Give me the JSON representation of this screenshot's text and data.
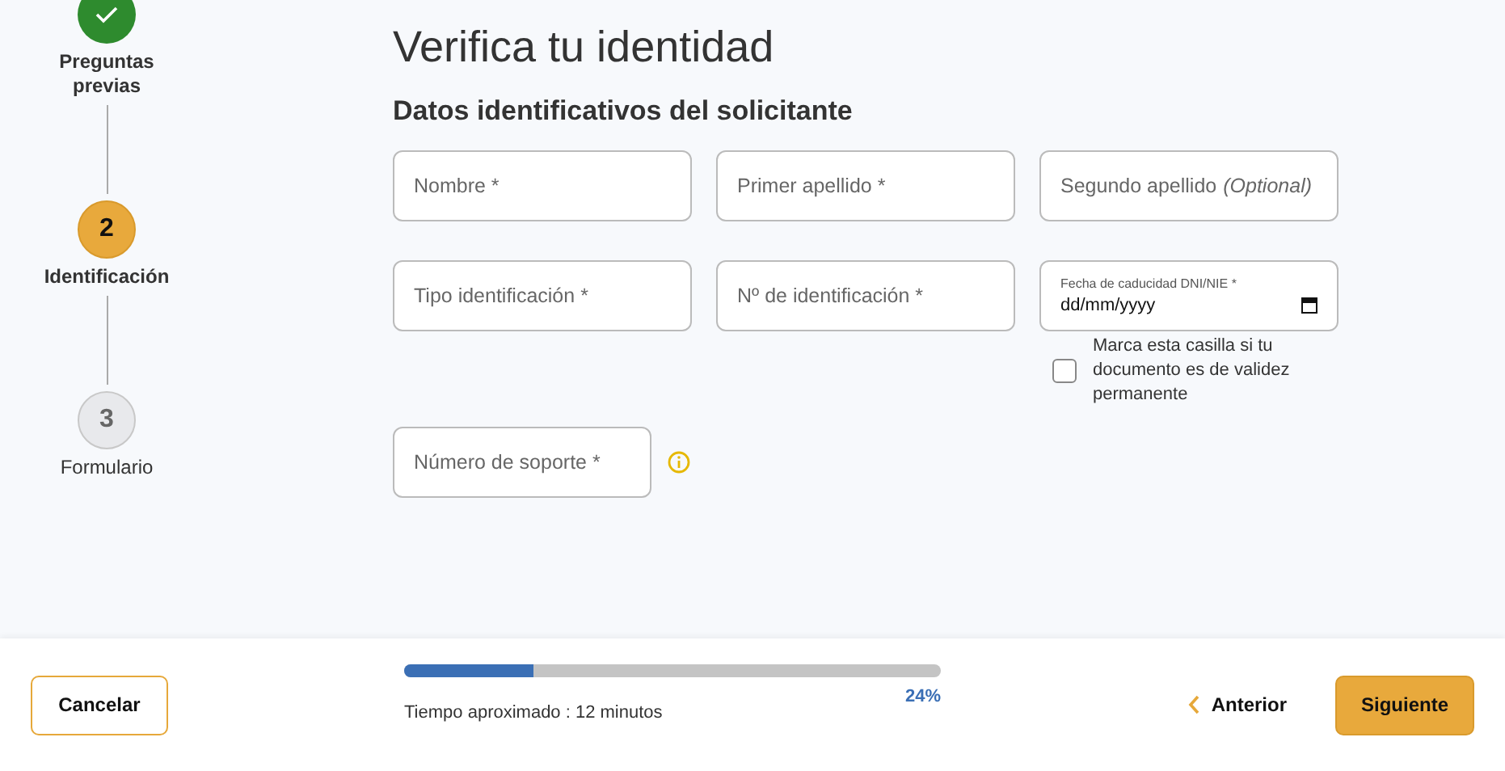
{
  "steps": [
    {
      "kind": "done",
      "label": "Preguntas previas"
    },
    {
      "kind": "current",
      "number": "2",
      "label": "Identificación"
    },
    {
      "kind": "pending",
      "number": "3",
      "label": "Formulario"
    }
  ],
  "title": "Verifica tu identidad",
  "section_title": "Datos identificativos del solicitante",
  "fields": [
    {
      "kind": "text",
      "placeholder": "Nombre *"
    },
    {
      "kind": "text",
      "placeholder": "Primer apellido *"
    },
    {
      "kind": "text",
      "placeholder": "Segundo apellido",
      "optional_note": "(Optional)"
    },
    {
      "kind": "text",
      "placeholder": "Tipo identificación *"
    },
    {
      "kind": "text",
      "placeholder": "Nº de identificación *"
    },
    {
      "kind": "date",
      "label": "Fecha de caducidad DNI/NIE *",
      "value": "dd/mm/yyyy"
    }
  ],
  "permanent_checkbox": {
    "label": "Marca esta casilla si tu documento es de validez permanente",
    "checked": false
  },
  "support_field": {
    "placeholder": "Número de soporte *"
  },
  "footer": {
    "cancel": "Cancelar",
    "progress": {
      "level": 0.24,
      "percent": "24%",
      "time": "Tiempo aproximado : 12 minutos"
    },
    "back": "Anterior",
    "next": "Siguiente"
  }
}
